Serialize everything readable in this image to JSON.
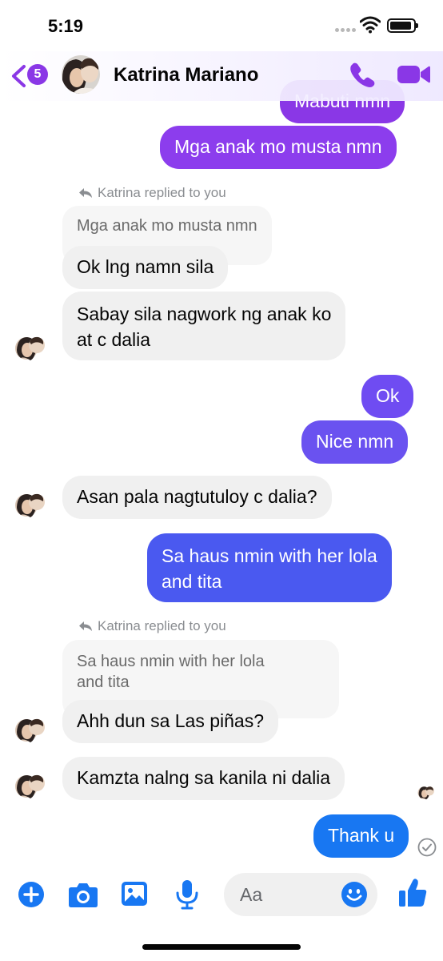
{
  "status_bar": {
    "time": "5:19"
  },
  "header": {
    "unread_count": "5",
    "contact_name": "Katrina Mariano"
  },
  "messages": [
    {
      "text": "Mabuti nmn"
    },
    {
      "text": "Mga anak mo musta nmn"
    },
    {
      "reply_note": "Katrina replied to you",
      "quoted": "Mga anak mo musta nmn"
    },
    {
      "text": "Ok lng namn sila"
    },
    {
      "text": "Sabay sila nagwork ng anak ko",
      "text2": "at c dalia"
    },
    {
      "text": "Ok"
    },
    {
      "text": "Nice nmn"
    },
    {
      "text": "Asan pala nagtutuloy c dalia?"
    },
    {
      "text": "Sa haus nmin with her lola",
      "text2": "and tita"
    },
    {
      "reply_note": "Katrina replied to you",
      "quoted": "Sa haus nmin with her lola",
      "quoted2": "and tita"
    },
    {
      "text": "Ahh dun sa Las piñas?"
    },
    {
      "text": "Kamzta nalng sa kanila ni dalia"
    },
    {
      "text": "Thank u"
    }
  ],
  "composer": {
    "placeholder": "Aa"
  },
  "colors": {
    "accent_purple": "#8a37e6",
    "blue": "#1877f2",
    "light_gray": "#f0f0f0"
  }
}
